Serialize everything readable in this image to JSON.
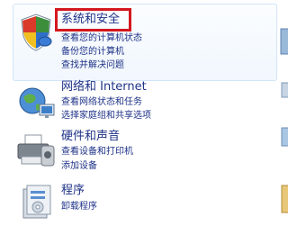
{
  "categories": [
    {
      "title": "系统和安全",
      "links": [
        "查看您的计算机状态",
        "备份您的计算机",
        "查找并解决问题"
      ],
      "icon": "shield-icon"
    },
    {
      "title": "网络和 Internet",
      "links": [
        "查看网络状态和任务",
        "选择家庭组和共享选项"
      ],
      "icon": "network-globe-icon"
    },
    {
      "title": "硬件和声音",
      "links": [
        "查看设备和打印机",
        "添加设备"
      ],
      "icon": "printer-icon"
    },
    {
      "title": "程序",
      "links": [
        "卸载程序"
      ],
      "icon": "programs-icon"
    }
  ],
  "colors": {
    "link": "#1e3287",
    "highlight_border": "#d4171e",
    "hover_border": "#d2e4f7"
  }
}
